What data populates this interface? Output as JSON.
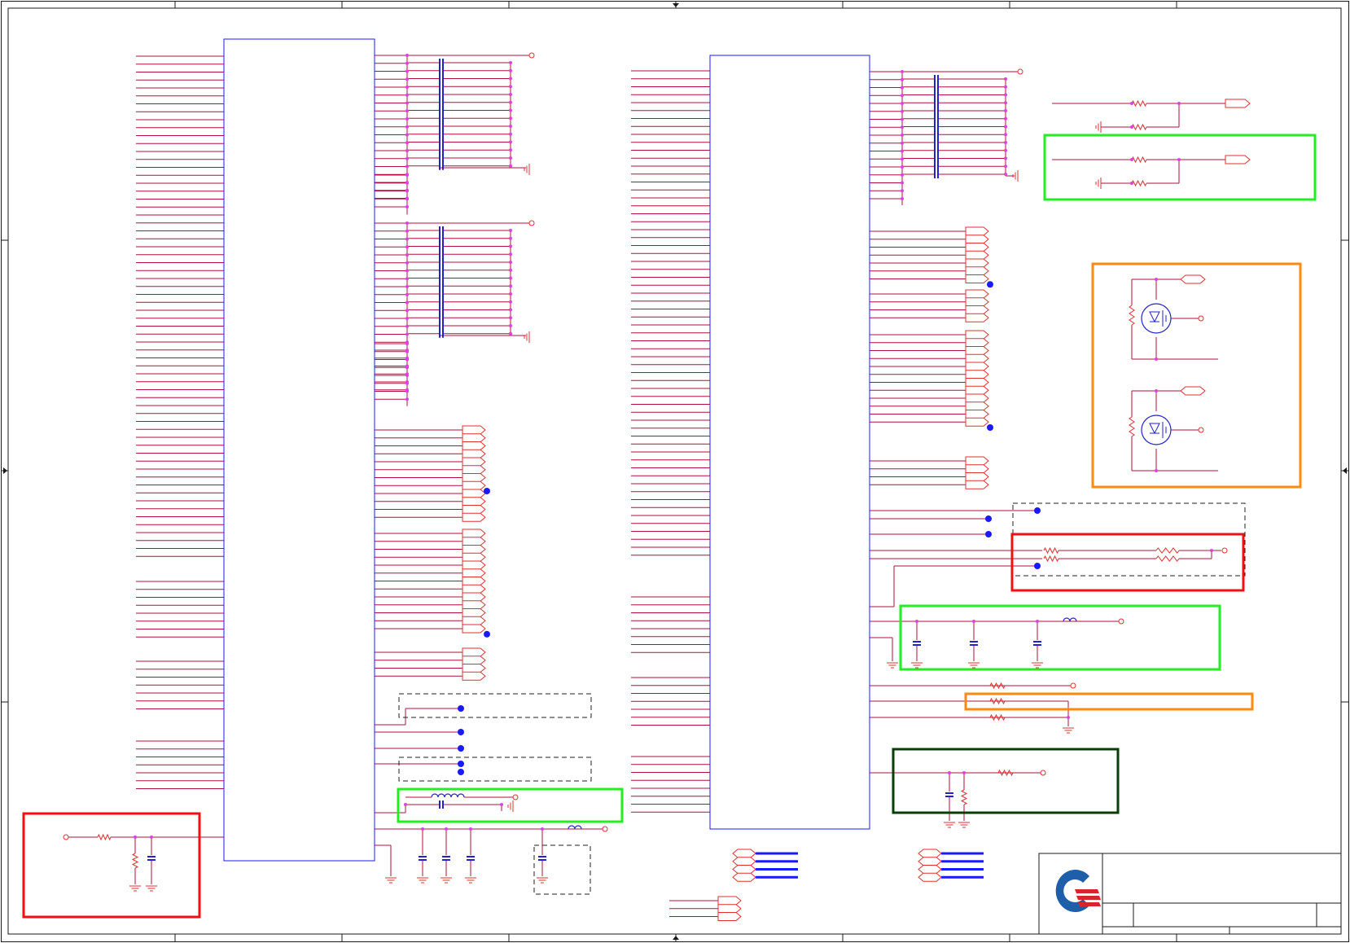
{
  "colors": {
    "frame": "#1a1a1a",
    "wire": "#b0103a",
    "body": "#1a1aff",
    "junction": "#e040e0",
    "ground": "#e03030",
    "cap": "#2222cc",
    "bus_dot": "#1a1aff",
    "box_green": "#22ee22",
    "box_red": "#ee1111",
    "box_orange": "#ff8a10",
    "box_darkgreen": "#0a3d0a",
    "dashed": "#222222",
    "logo_blue": "#1f5ea8",
    "logo_red": "#d6252d"
  },
  "icons": [
    "ground-icon",
    "capacitor-icon",
    "resistor-icon",
    "inductor-icon",
    "mosfet-icon",
    "port-icon",
    "test-point-icon",
    "logo-icon"
  ]
}
